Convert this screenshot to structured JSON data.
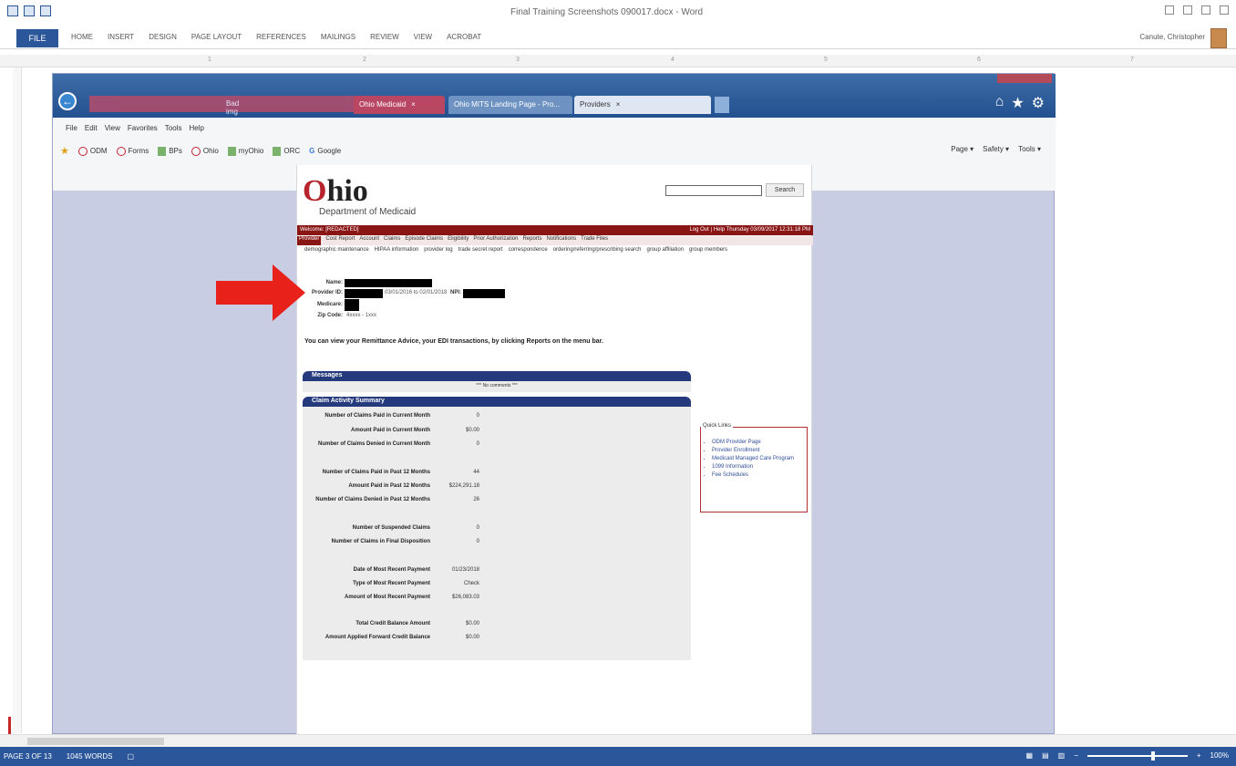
{
  "word": {
    "title": "Final Training Screenshots 090017.docx - Word",
    "file_tab": "FILE",
    "tabs": [
      "HOME",
      "INSERT",
      "DESIGN",
      "PAGE LAYOUT",
      "REFERENCES",
      "MAILINGS",
      "REVIEW",
      "VIEW",
      "ACROBAT"
    ],
    "user": "Canute, Christopher",
    "ruler_ticks": [
      "1",
      "2",
      "3",
      "4",
      "5",
      "6",
      "7"
    ],
    "status_page": "PAGE 3 OF 13",
    "status_words": "1045 WORDS",
    "zoom": "100%"
  },
  "browser": {
    "address_text": "Bad img",
    "tabs": [
      {
        "label": "Ohio Medicaid",
        "close": "×"
      },
      {
        "label": "Ohio MITS Landing Page - Pro...",
        "close": ""
      },
      {
        "label": "Providers",
        "close": "×"
      }
    ],
    "menu": [
      "File",
      "Edit",
      "View",
      "Favorites",
      "Tools",
      "Help"
    ],
    "favorites": [
      "ODM",
      "Forms",
      "BPs",
      "Ohio",
      "myOhio",
      "ORC",
      "Google"
    ],
    "command_bar": [
      "Page ▾",
      "Safety ▾",
      "Tools ▾"
    ]
  },
  "ohio_page": {
    "logo_o": "O",
    "logo_rest": "hio",
    "logo_sub": "Department of Medicaid",
    "search_button": "Search",
    "welcome": "Welcome: [REDACTED]",
    "top_right": "Log Out | Help   Thursday 03/09/2017 12:31:18 PM",
    "nav_primary": [
      "Provider",
      "Cost Report",
      "Account",
      "Claims",
      "Episode Claims",
      "Eligibility",
      "Prior Authorization",
      "Reports",
      "Notifications",
      "Trade Files"
    ],
    "nav_secondary": [
      "demographic maintenance",
      "HIPAA information",
      "provider log",
      "trade secret report",
      "correspondence",
      "ordering/referring/prescribing search",
      "group affiliation",
      "group members"
    ],
    "fields": {
      "name_label": "Name:",
      "provider_id_label": "Provider ID:",
      "provider_dates": "03/01/2016 to 02/01/2018",
      "npi_label": "NPI:",
      "medicare_label": "Medicare:",
      "zip_label": "Zip Code:",
      "zip_value": "4xxxx - 1xxx"
    },
    "instructions": "You can view your Remittance Advice, your EDI transactions, by clicking Reports on the menu bar.",
    "messages_title": "Messages",
    "messages_empty": "*** No comments ***",
    "claims_title": "Claim Activity Summary",
    "claims_rows": [
      {
        "label": "Number of Claims Paid in Current Month",
        "value": "0"
      },
      {
        "label": "Amount Paid in Current Month",
        "value": "$0.00"
      },
      {
        "label": "Number of Claims Denied in Current Month",
        "value": "0"
      },
      {
        "label": "Number of Claims Paid in Past 12 Months",
        "value": "44"
      },
      {
        "label": "Amount Paid in Past 12 Months",
        "value": "$224,291.18"
      },
      {
        "label": "Number of Claims Denied in Past 12 Months",
        "value": "26"
      },
      {
        "label": "Number of Suspended Claims",
        "value": "0"
      },
      {
        "label": "Number of Claims in Final Disposition",
        "value": "0"
      },
      {
        "label": "Date of Most Recent Payment",
        "value": "01/23/2018"
      },
      {
        "label": "Type of Most Recent Payment",
        "value": "Check"
      },
      {
        "label": "Amount of Most Recent Payment",
        "value": "$26,083.03"
      },
      {
        "label": "Total Credit Balance Amount",
        "value": "$0.00"
      },
      {
        "label": "Amount Applied Forward Credit Balance",
        "value": "$0.00"
      }
    ],
    "quick_links_title": "Quick Links",
    "quick_links": [
      "ODM Provider Page",
      "Provider Enrollment",
      "Medicaid Managed Care Program",
      "1099 Information",
      "Fee Schedules"
    ]
  },
  "colors": {
    "word_blue": "#2b579a",
    "ohio_red": "#8a1515",
    "panel_navy": "#253a7c",
    "arrow_red": "#e8221b"
  }
}
